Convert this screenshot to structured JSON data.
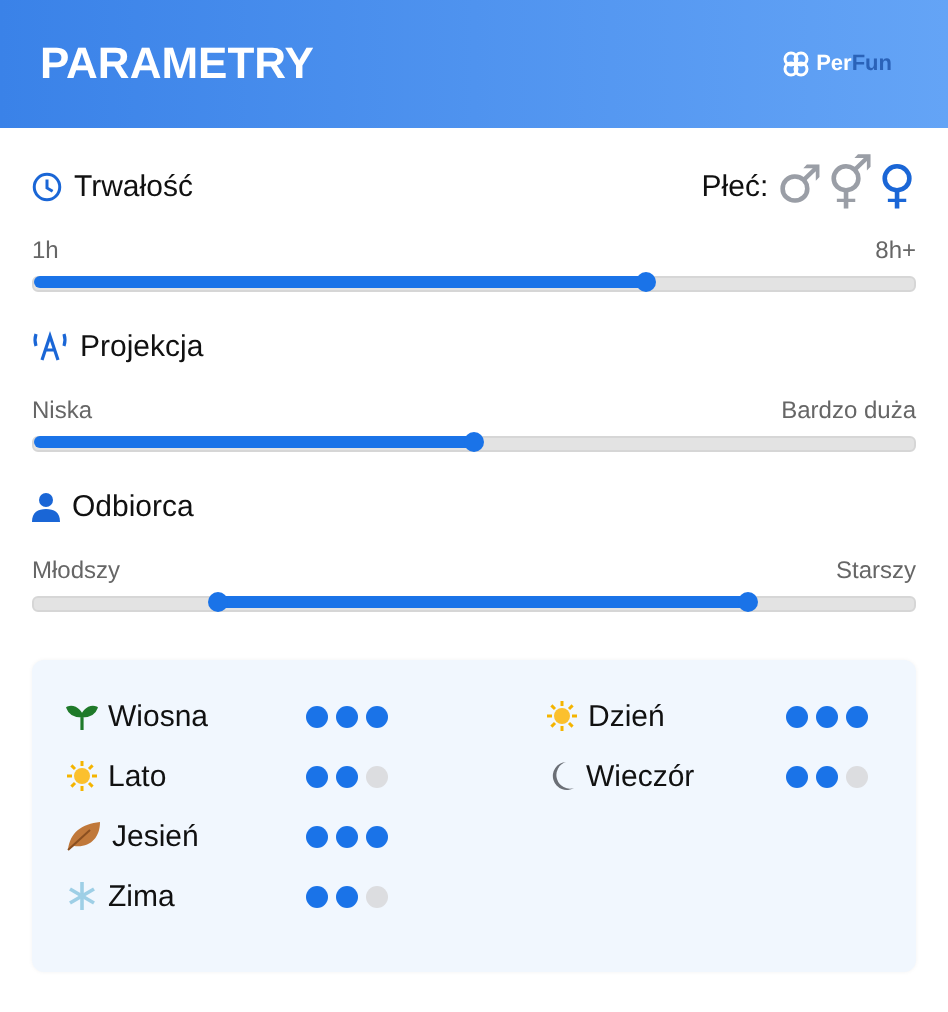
{
  "header": {
    "title": "PARAMETRY",
    "logo": {
      "part_1": "Per",
      "part_2": "Fun"
    }
  },
  "duration": {
    "label": "Trwałość",
    "min_label": "1h",
    "max_label": "8h+",
    "level": 0.695
  },
  "gender": {
    "label": "Płeć:",
    "options": [
      {
        "symbol": "♂",
        "selected": false
      },
      {
        "symbol": "⚥",
        "selected": false
      },
      {
        "symbol": "♀",
        "selected": true
      }
    ]
  },
  "projection": {
    "label": "Projekcja",
    "min_label": "Niska",
    "max_label": "Bardzo duża",
    "level": 0.5
  },
  "audience": {
    "label": "Odbiorca",
    "min_label": "Młodszy",
    "max_label": "Starszy",
    "thumbs": [
      {
        "level": 0.21
      },
      {
        "level": 0.812
      }
    ]
  },
  "seasons": [
    {
      "kind": "sprout",
      "label": "Wiosna",
      "stars": 3
    },
    {
      "kind": "sun",
      "label": "Lato",
      "stars": 2
    },
    {
      "kind": "leaf",
      "label": "Jesień",
      "stars": 3
    },
    {
      "kind": "snow",
      "label": "Zima",
      "stars": 2
    }
  ],
  "times": [
    {
      "kind": "sun",
      "label": "Dzień",
      "stars": 3
    },
    {
      "kind": "moon",
      "label": "Wieczór",
      "stars": 2
    }
  ]
}
